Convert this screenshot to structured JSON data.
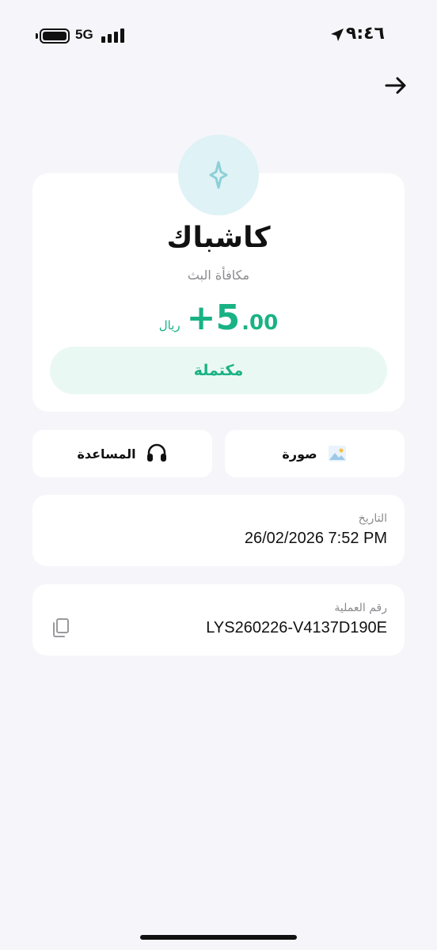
{
  "status_bar": {
    "network": "5G",
    "time": "٩:٤٦"
  },
  "transaction": {
    "title": "كاشباك",
    "subtitle": "مكافأة البث",
    "amount_integer": "+5",
    "amount_decimal": ".00",
    "currency": "ريال",
    "status": "مكتملة",
    "accent_color": "#19b284"
  },
  "actions": {
    "image_label": "صورة",
    "help_label": "المساعدة"
  },
  "details": {
    "date_label": "التاريخ",
    "date_value": "26/02/2026 7:52 PM",
    "ref_label": "رقم العملية",
    "ref_value": "LYS260226-V4137D190E"
  }
}
